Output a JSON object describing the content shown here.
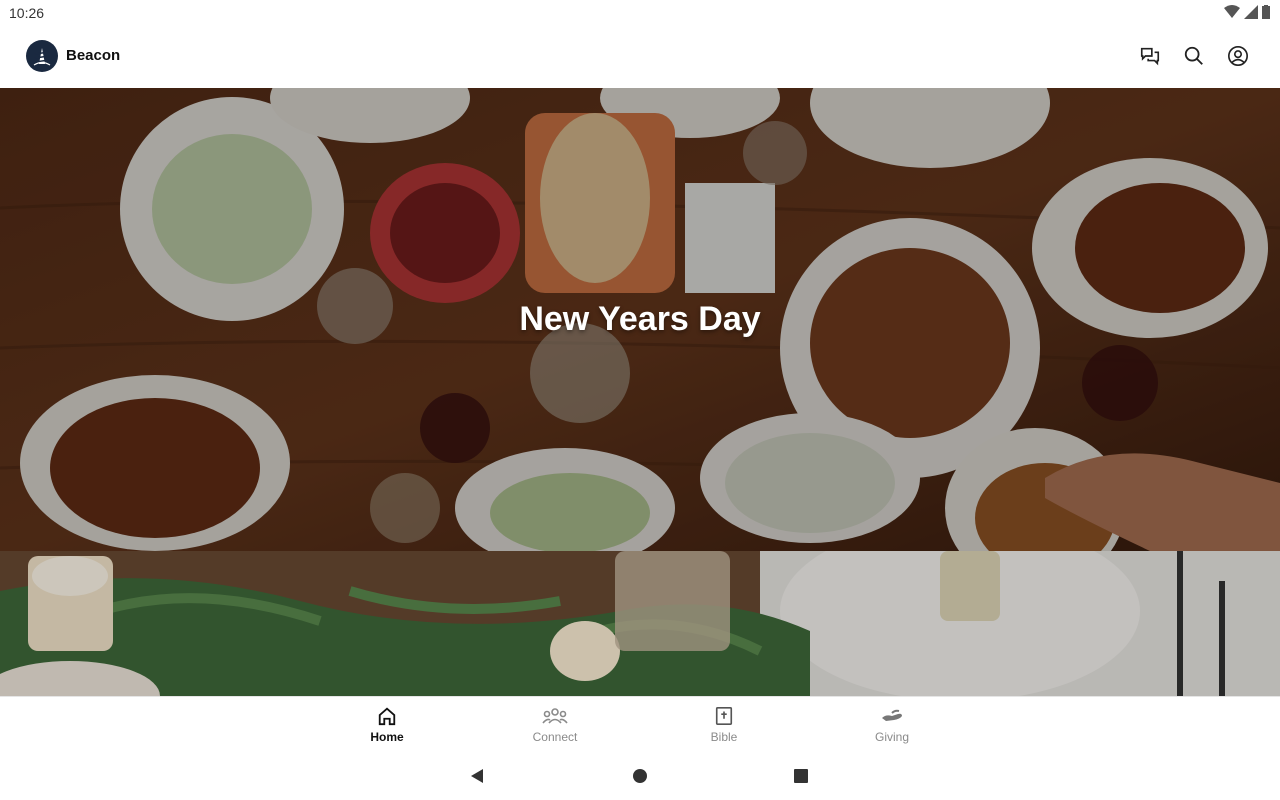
{
  "status_bar": {
    "time": "10:26"
  },
  "app": {
    "title": "Beacon"
  },
  "actions": {
    "messages_icon": "chat-bubbles-icon",
    "search_icon": "search-icon",
    "profile_icon": "account-circle-icon"
  },
  "feed": {
    "cards": [
      {
        "title": "New Years Day"
      },
      {
        "title": ""
      }
    ]
  },
  "bottom_nav": {
    "items": [
      {
        "label": "Home",
        "icon": "home-icon",
        "active": true
      },
      {
        "label": "Connect",
        "icon": "people-icon",
        "active": false
      },
      {
        "label": "Bible",
        "icon": "bible-icon",
        "active": false
      },
      {
        "label": "Giving",
        "icon": "giving-hand-icon",
        "active": false
      }
    ]
  },
  "colors": {
    "brand": "#1a2940",
    "inactive": "#8a8a8a"
  }
}
